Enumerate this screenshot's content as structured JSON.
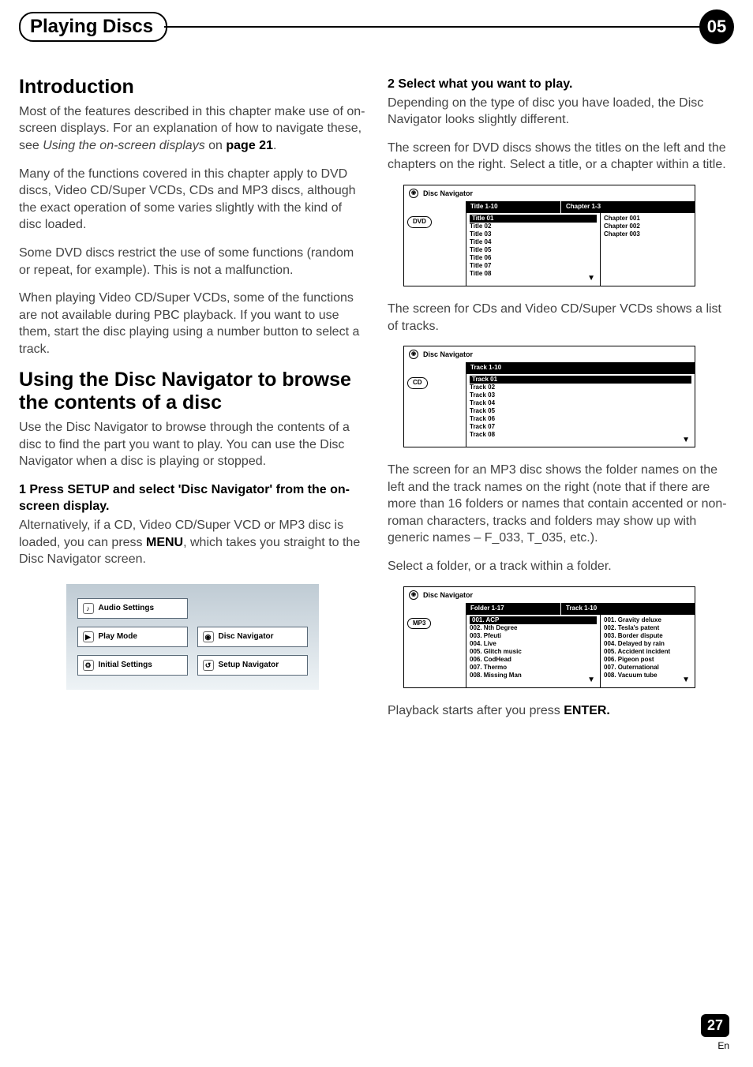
{
  "header": {
    "chapter_title": "Playing Discs",
    "chapter_number": "05"
  },
  "left": {
    "intro_heading": "Introduction",
    "intro_p1a": "Most of the features described in this chapter make use of on-screen displays. For an explanation of how to navigate these, see ",
    "intro_p1_italic": "Using the on-screen displays",
    "intro_p1b": " on ",
    "intro_p1_bold": "page 21",
    "intro_p1c": ".",
    "intro_p2": "Many of the functions covered in this chapter apply to DVD discs, Video CD/Super VCDs, CDs and MP3 discs, although the exact operation of some varies slightly with the kind of disc loaded.",
    "intro_p3": "Some DVD discs restrict the use of some functions (random or repeat, for example). This is not a malfunction.",
    "intro_p4": "When playing Video CD/Super VCDs, some of the functions are not available during PBC playback. If you want to use them, start the disc playing using a number button to select a track.",
    "nav_heading": "Using the Disc Navigator to browse the contents of a disc",
    "nav_p1": "Use the Disc Navigator to browse through the contents of a disc to find the part you want to play. You can use the Disc Navigator when a disc is playing or stopped.",
    "step1_title": "1    Press SETUP and select 'Disc Navigator' from the on-screen display.",
    "step1_body_a": "Alternatively, if a CD, Video CD/Super VCD or MP3 disc is loaded, you can press ",
    "step1_menu": "MENU",
    "step1_body_b": ", which takes you straight to the Disc Navigator screen.",
    "menu_items": {
      "audio": "Audio Settings",
      "play_mode": "Play Mode",
      "disc_nav": "Disc Navigator",
      "initial": "Initial Settings",
      "setup_nav": "Setup Navigator"
    }
  },
  "right": {
    "step2_title": "2    Select what you want to play.",
    "step2_body": "Depending on the type of disc you have loaded, the Disc Navigator looks slightly different.",
    "dvd_intro": "The screen for DVD discs shows the titles on the left and the chapters on the right. Select a title, or a chapter within a title.",
    "cd_intro": "The screen for CDs and Video CD/Super VCDs shows a list of tracks.",
    "mp3_intro": "The screen for an MP3 disc shows the folder names on the left and the track names on the right (note that if there are more than 16 folders or names that contain accented or non-roman characters, tracks and folders may show up with generic names – F_033, T_035, etc.).",
    "mp3_select": "Select a folder, or a track within a folder.",
    "playback_a": "Playback starts after you press ",
    "playback_b": "ENTER."
  },
  "nav_common": {
    "label": "Disc Navigator"
  },
  "dvd_nav": {
    "tag": "DVD",
    "hdr_left": "Title 1-10",
    "hdr_right": "Chapter 1-3",
    "titles": [
      "Title 01",
      "Title 02",
      "Title 03",
      "Title 04",
      "Title 05",
      "Title 06",
      "Title 07",
      "Title 08"
    ],
    "chapters": [
      "Chapter 001",
      "Chapter 002",
      "Chapter 003"
    ]
  },
  "cd_nav": {
    "tag": "CD",
    "hdr": "Track 1-10",
    "tracks": [
      "Track 01",
      "Track 02",
      "Track 03",
      "Track 04",
      "Track 05",
      "Track 06",
      "Track 07",
      "Track 08"
    ]
  },
  "mp3_nav": {
    "tag": "MP3",
    "hdr_left": "Folder 1-17",
    "hdr_right": "Track 1-10",
    "folders": [
      "001. ACP",
      "002. Nth Degree",
      "003. Pfeuti",
      "004. Live",
      "005. Glitch music",
      "006. CodHead",
      "007. Thermo",
      "008. Missing Man"
    ],
    "tracks": [
      "001. Gravity deluxe",
      "002. Tesla's patent",
      "003. Border dispute",
      "004. Delayed by rain",
      "005. Accident incident",
      "006. Pigeon post",
      "007. Outernational",
      "008. Vacuum tube"
    ]
  },
  "footer": {
    "page": "27",
    "lang": "En"
  }
}
